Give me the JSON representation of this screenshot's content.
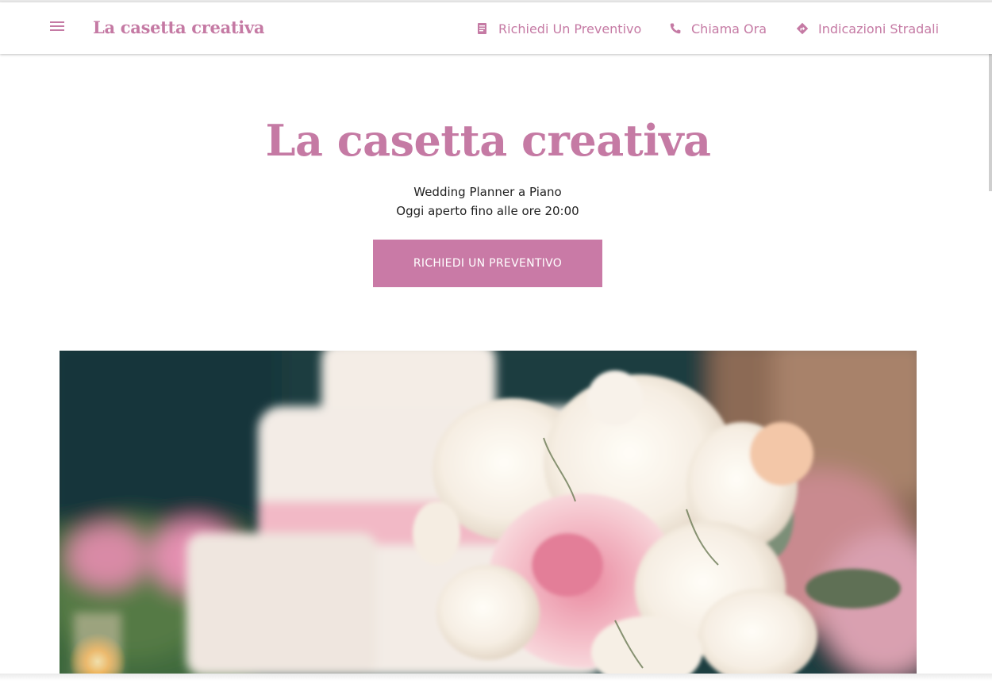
{
  "header": {
    "brand": "La casetta creativa",
    "menu_icon": "hamburger-menu-icon",
    "links": [
      {
        "label": "Richiedi Un Preventivo",
        "icon": "document-icon"
      },
      {
        "label": "Chiama Ora",
        "icon": "phone-icon"
      },
      {
        "label": "Indicazioni Stradali",
        "icon": "directions-icon"
      }
    ]
  },
  "hero": {
    "title": "La casetta creativa",
    "subtitle": "Wedding Planner a Piano",
    "hours": "Oggi aperto fino alle ore 20:00",
    "cta_label": "RICHIEDI UN PREVENTIVO",
    "image": "wedding-cake-and-flowers-photo"
  },
  "colors": {
    "accent": "#c57aa4",
    "button": "#c97aa6"
  }
}
